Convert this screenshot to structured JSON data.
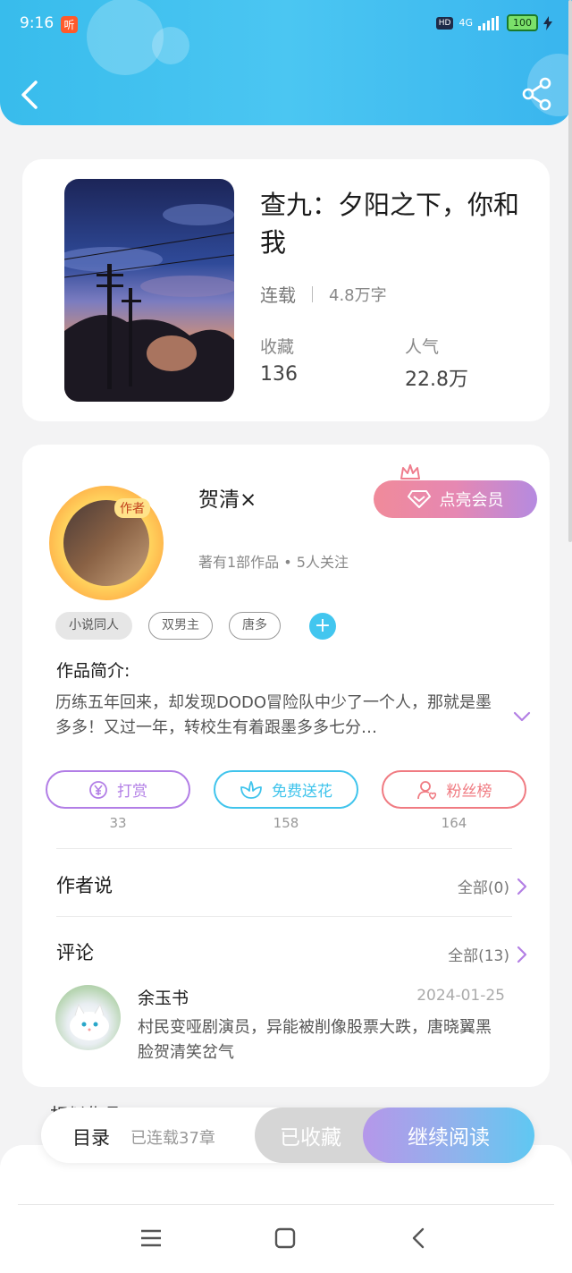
{
  "status_bar": {
    "time": "9:16",
    "app_badge": "听",
    "hd": "HD",
    "network": "4G",
    "battery": "100"
  },
  "book": {
    "title": "查九：夕阳之下，你和我",
    "status": "连载",
    "words": "4.8万字",
    "collect_label": "收藏",
    "collect_value": "136",
    "popularity_label": "人气",
    "popularity_value": "22.8万"
  },
  "author": {
    "badge": "作者",
    "name": "贺清×",
    "info": "著有1部作品 • 5人关注",
    "vip_label": "点亮会员"
  },
  "tags": [
    "小说同人",
    "双男主",
    "唐多"
  ],
  "intro": {
    "label": "作品简介:",
    "text": "历练五年回来，却发现DODO冒险队中少了一个人，那就是墨多多！又过一年，转校生有着跟墨多多七分…"
  },
  "actions": {
    "reward_label": "打赏",
    "reward_count": "33",
    "flower_label": "免费送花",
    "flower_count": "158",
    "fans_label": "粉丝榜",
    "fans_count": "164"
  },
  "author_says": {
    "title": "作者说",
    "link": "全部(0)"
  },
  "comments": {
    "title": "评论",
    "link": "全部(13)",
    "items": [
      {
        "name": "余玉书",
        "date": "2024-01-25",
        "text": "村民变哑剧演员，异能被削像股票大跌，唐晓翼黑脸贺清笑岔气"
      }
    ]
  },
  "peek_section": "相似作品",
  "reader_bar": {
    "toc": "目录",
    "chapters": "已连载37章",
    "collected": "已收藏",
    "continue": "继续阅读"
  },
  "colors": {
    "header": "#3fc0ef",
    "reward": "#b27ee6",
    "flower": "#40c4ec",
    "fans": "#f07b82"
  }
}
